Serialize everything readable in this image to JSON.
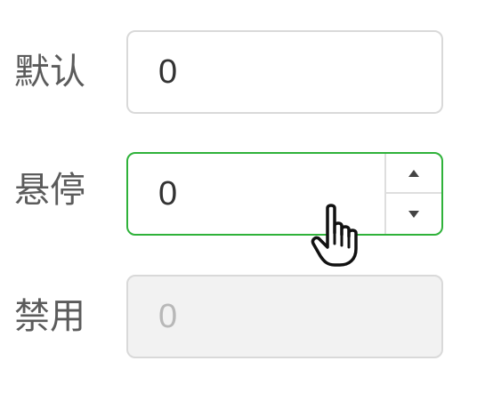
{
  "rows": [
    {
      "label": "默认",
      "value": "0",
      "state": "default"
    },
    {
      "label": "悬停",
      "value": "0",
      "state": "hover"
    },
    {
      "label": "禁用",
      "value": "0",
      "state": "disabled"
    }
  ],
  "colors": {
    "label": "#5b5b5b",
    "border_default": "#d9d9d9",
    "border_hover": "#2fb23a",
    "disabled_bg": "#f2f2f2",
    "disabled_text": "#b8b8b8"
  },
  "icons": {
    "increment": "caret-up-icon",
    "decrement": "caret-down-icon",
    "cursor": "hand-pointer-cursor-icon"
  }
}
